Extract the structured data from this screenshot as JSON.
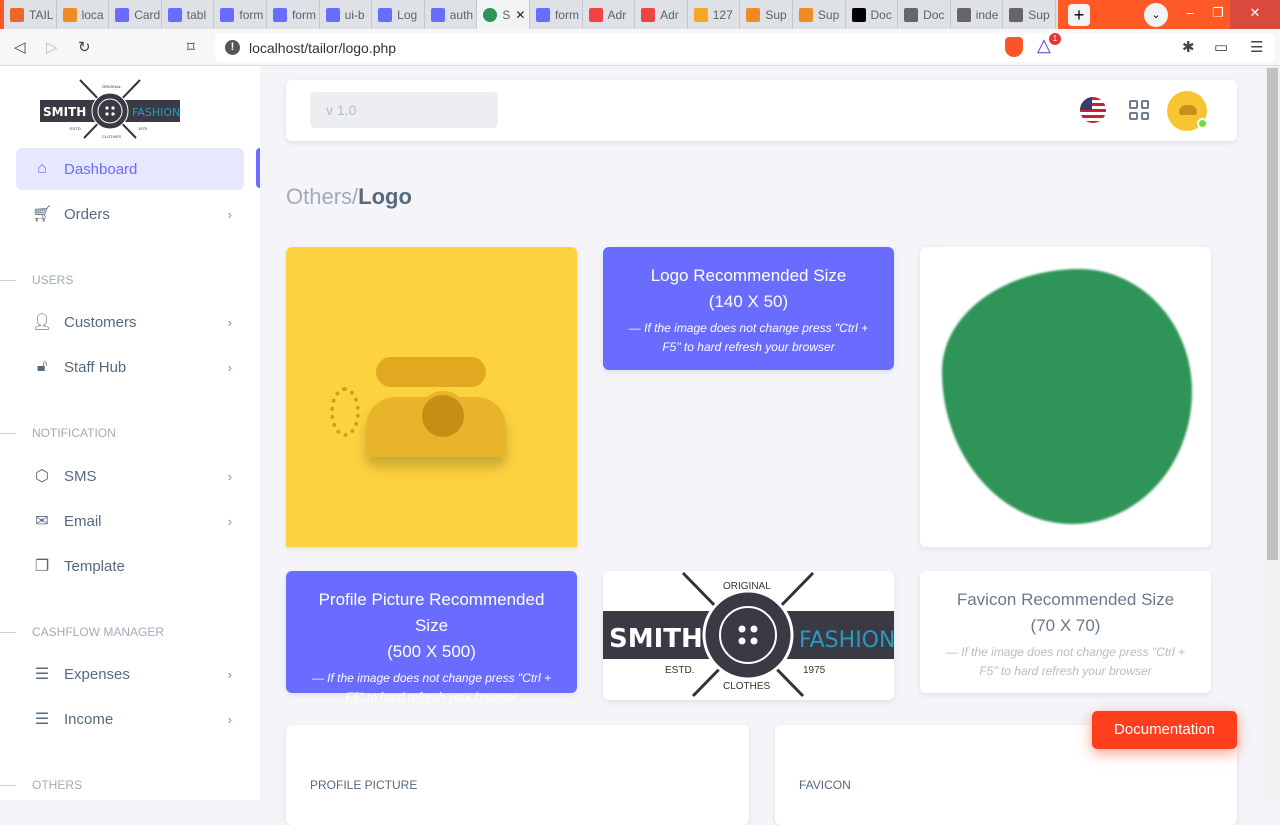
{
  "browser": {
    "tabs": [
      {
        "label": "TAIL",
        "color": "#f06529"
      },
      {
        "label": "loca",
        "color": "#f08a24"
      },
      {
        "label": "Card",
        "color": "#696cff"
      },
      {
        "label": "tabl",
        "color": "#696cff"
      },
      {
        "label": "form",
        "color": "#696cff"
      },
      {
        "label": "form",
        "color": "#696cff"
      },
      {
        "label": "ui-b",
        "color": "#696cff"
      },
      {
        "label": "Log",
        "color": "#696cff"
      },
      {
        "label": "auth",
        "color": "#696cff"
      },
      {
        "label": "S",
        "color": "#2e9457",
        "active": true
      },
      {
        "label": "form",
        "color": "#696cff"
      },
      {
        "label": "Adr",
        "color": "#ef4444"
      },
      {
        "label": "Adr",
        "color": "#ef4444"
      },
      {
        "label": "127",
        "color": "#f5a623"
      },
      {
        "label": "Sup",
        "color": "#f08a24"
      },
      {
        "label": "Sup",
        "color": "#f08a24"
      },
      {
        "label": "Doc",
        "color": "#000000"
      },
      {
        "label": "Doc",
        "color": "#666666"
      },
      {
        "label": "inde",
        "color": "#666666"
      },
      {
        "label": "Sup",
        "color": "#666666"
      }
    ],
    "url": "localhost/tailor/logo.php",
    "notification_count": "1"
  },
  "logo": {
    "left": "SMITH",
    "right": "FASHION",
    "top": "ORIGINAL",
    "bottom": "CLOTHES",
    "estd": "ESTD.",
    "year": "1975"
  },
  "sidebar": {
    "items": [
      {
        "label": "Dashboard",
        "icon": "home"
      },
      {
        "label": "Orders",
        "icon": "cart"
      },
      {
        "label": "Customers",
        "icon": "user"
      },
      {
        "label": "Staff Hub",
        "icon": "lock"
      },
      {
        "label": "SMS",
        "icon": "hexagon"
      },
      {
        "label": "Email",
        "icon": "mail"
      },
      {
        "label": "Template",
        "icon": "copy"
      },
      {
        "label": "Expenses",
        "icon": "list"
      },
      {
        "label": "Income",
        "icon": "list"
      }
    ],
    "sections": [
      "USERS",
      "NOTIFICATION",
      "CASHFLOW MANAGER",
      "OTHERS"
    ]
  },
  "header": {
    "version": "v 1.0"
  },
  "page": {
    "breadcrumb_parent": "Others/",
    "breadcrumb_current": "Logo"
  },
  "cards": {
    "logo_info": {
      "title": "Logo Recommended Size",
      "size": "(140 X 50)",
      "note": "— If the image does not change press \"Ctrl + F5\" to hard refresh your browser"
    },
    "profile_info": {
      "title": "Profile Picture Recommended Size",
      "size": "(500 X 500)",
      "note": "— If the image does not change press \"Ctrl + F5\" to hard refresh your browser"
    },
    "favicon_info": {
      "title": "Favicon Recommended Size",
      "size": "(70 X 70)",
      "note": "— If the image does not change press \"Ctrl + F5\" to hard refresh your browser"
    },
    "profile_label": "PROFILE PICTURE",
    "favicon_label": "FAVICON"
  },
  "documentation": "Documentation"
}
